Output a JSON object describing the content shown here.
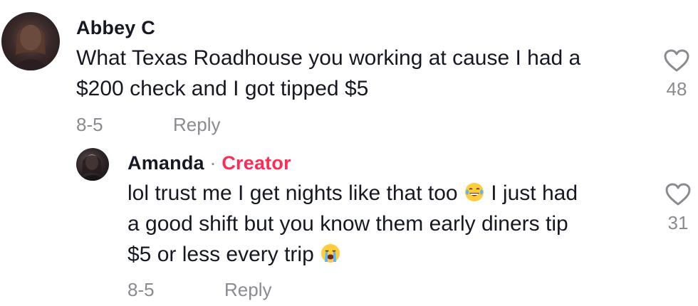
{
  "comment": {
    "username": "Abbey C",
    "text_line1": "What Texas Roadhouse you working at cause I had a",
    "text_line2": "$200 check and I got tipped $5",
    "date": "8-5",
    "reply_label": "Reply",
    "like_count": "48",
    "like_icon": "heart-outline-icon"
  },
  "reply": {
    "username": "Amanda",
    "separator": "·",
    "badge": "Creator",
    "text_line1_a": "lol trust me I get nights like that too",
    "emoji1": "face-with-tears-of-joy",
    "text_line1_b": "I just had",
    "text_line2": "a good shift but you know them early diners tip",
    "text_line3": "$5 or less every trip",
    "emoji2": "loudly-crying-face",
    "date": "8-5",
    "reply_label": "Reply",
    "like_count": "31",
    "like_icon": "heart-outline-icon"
  },
  "colors": {
    "text": "#161823",
    "secondary": "#8a8b91",
    "creator_badge": "#fe2c55"
  }
}
